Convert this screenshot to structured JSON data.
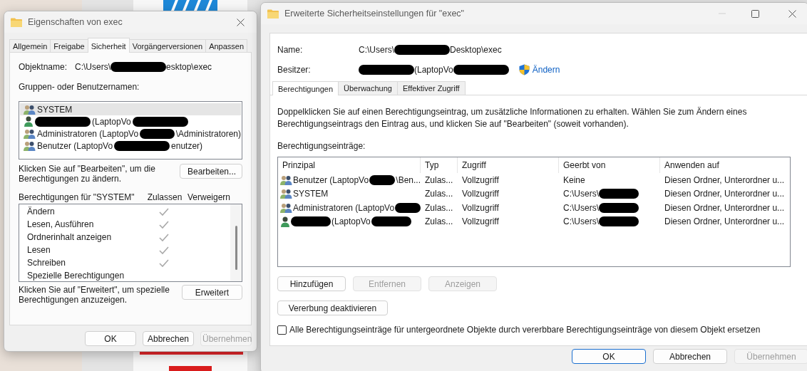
{
  "left_window": {
    "title": "Eigenschaften von exec",
    "tabs": [
      {
        "label": "Allgemein",
        "selected": false
      },
      {
        "label": "Freigabe",
        "selected": false
      },
      {
        "label": "Sicherheit",
        "selected": true
      },
      {
        "label": "Vorgängerversionen",
        "selected": false
      },
      {
        "label": "Anpassen",
        "selected": false
      }
    ],
    "object_name": {
      "label": "Objektname:",
      "value": [
        {
          "kind": "text",
          "text": "C:\\Users\\"
        },
        {
          "kind": "redacted"
        },
        {
          "kind": "text",
          "text": "esktop\\exec"
        }
      ]
    },
    "groups_label": "Gruppen- oder Benutzernamen:",
    "principals": [
      {
        "kind": "group",
        "selected": true,
        "name": [
          {
            "kind": "text",
            "text": "SYSTEM"
          }
        ]
      },
      {
        "kind": "user",
        "selected": false,
        "name": [
          {
            "kind": "redacted"
          },
          {
            "kind": "text",
            "text": "(LaptopVo"
          },
          {
            "kind": "redacted"
          }
        ]
      },
      {
        "kind": "group",
        "selected": false,
        "name": [
          {
            "kind": "text",
            "text": "Administratoren (LaptopVo"
          },
          {
            "kind": "redacted"
          },
          {
            "kind": "text",
            "text": "\\Administratoren)"
          }
        ]
      },
      {
        "kind": "group",
        "selected": false,
        "name": [
          {
            "kind": "text",
            "text": "Benutzer (LaptopVo"
          },
          {
            "kind": "redacted"
          },
          {
            "kind": "text",
            "text": "enutzer)"
          }
        ]
      }
    ],
    "edit_hint": "Klicken Sie auf \"Bearbeiten\", um die Berechtigungen zu ändern.",
    "edit_button": "Bearbeiten...",
    "permissions_label": "Berechtigungen für \"SYSTEM\"",
    "allow_header": "Zulassen",
    "deny_header": "Verweigern",
    "permissions": [
      {
        "name": "Ändern",
        "allow": true,
        "deny": false
      },
      {
        "name": "Lesen, Ausführen",
        "allow": true,
        "deny": false
      },
      {
        "name": "Ordnerinhalt anzeigen",
        "allow": true,
        "deny": false
      },
      {
        "name": "Lesen",
        "allow": true,
        "deny": false
      },
      {
        "name": "Schreiben",
        "allow": true,
        "deny": false
      },
      {
        "name": "Spezielle Berechtigungen",
        "allow": false,
        "deny": false
      }
    ],
    "advanced_hint": "Klicken Sie auf \"Erweitert\", um spezielle Berechtigungen anzuzeigen.",
    "advanced_button": "Erweitert",
    "buttons": [
      {
        "label": "OK",
        "disabled": false,
        "default": false
      },
      {
        "label": "Abbrechen",
        "disabled": false,
        "default": false
      },
      {
        "label": "Übernehmen",
        "disabled": true,
        "default": false
      }
    ]
  },
  "right_window": {
    "title": "Erweiterte Sicherheitseinstellungen für \"exec\"",
    "name": {
      "label": "Name:",
      "value": [
        {
          "kind": "text",
          "text": "C:\\Users\\"
        },
        {
          "kind": "redacted"
        },
        {
          "kind": "text",
          "text": "Desktop\\exec"
        }
      ]
    },
    "owner": {
      "label": "Besitzer:",
      "value": [
        {
          "kind": "redacted"
        },
        {
          "kind": "text",
          "text": "(LaptopVo"
        },
        {
          "kind": "redacted"
        }
      ],
      "change_link": "Ändern"
    },
    "tabs": [
      {
        "label": "Berechtigungen",
        "selected": true
      },
      {
        "label": "Überwachung",
        "selected": false
      },
      {
        "label": "Effektiver Zugriff",
        "selected": false
      }
    ],
    "description": "Doppelklicken Sie auf einen Berechtigungseintrag, um zusätzliche Informationen zu erhalten. Wählen Sie zum Ändern eines Berechtigungseintrags den Eintrag aus, und klicken Sie auf \"Bearbeiten\" (soweit vorhanden).",
    "entries_label": "Berechtigungseinträge:",
    "table": {
      "columns": [
        "Prinzipal",
        "Typ",
        "Zugriff",
        "Geerbt von",
        "Anwenden auf"
      ],
      "rows": [
        {
          "kind": "group",
          "principal": [
            {
              "kind": "text",
              "text": "Benutzer (LaptopVo"
            },
            {
              "kind": "redacted"
            },
            {
              "kind": "text",
              "text": "\\Ben..."
            }
          ],
          "type": "Zulas...",
          "access": "Vollzugriff",
          "inherited_from": [
            {
              "kind": "text",
              "text": "Keine"
            }
          ],
          "applies_to": "Diesen Ordner, Unterordner u..."
        },
        {
          "kind": "group",
          "principal": [
            {
              "kind": "text",
              "text": "SYSTEM"
            }
          ],
          "type": "Zulas...",
          "access": "Vollzugriff",
          "inherited_from": [
            {
              "kind": "text",
              "text": "C:\\Users\\"
            },
            {
              "kind": "redacted"
            }
          ],
          "applies_to": "Diesen Ordner, Unterordner u..."
        },
        {
          "kind": "group",
          "principal": [
            {
              "kind": "text",
              "text": "Administratoren (LaptopVo"
            },
            {
              "kind": "redacted"
            }
          ],
          "type": "Zulas...",
          "access": "Vollzugriff",
          "inherited_from": [
            {
              "kind": "text",
              "text": "C:\\Users\\"
            },
            {
              "kind": "redacted"
            }
          ],
          "applies_to": "Diesen Ordner, Unterordner u..."
        },
        {
          "kind": "user",
          "principal": [
            {
              "kind": "redacted"
            },
            {
              "kind": "text",
              "text": "(LaptopVo"
            },
            {
              "kind": "redacted"
            }
          ],
          "type": "Zulas...",
          "access": "Vollzugriff",
          "inherited_from": [
            {
              "kind": "text",
              "text": "C:\\Users\\"
            },
            {
              "kind": "redacted"
            }
          ],
          "applies_to": "Diesen Ordner, Unterordner u..."
        }
      ]
    },
    "entry_buttons": [
      {
        "label": "Hinzufügen",
        "disabled": false
      },
      {
        "label": "Entfernen",
        "disabled": true
      },
      {
        "label": "Anzeigen",
        "disabled": true
      }
    ],
    "inheritance_button": "Vererbung deaktivieren",
    "replace_checkbox": {
      "label": "Alle Berechtigungseinträge für untergeordnete Objekte durch vererbbare Berechtigungseinträge von diesem Objekt ersetzen",
      "checked": false
    },
    "buttons": [
      {
        "label": "OK",
        "disabled": false,
        "default": true
      },
      {
        "label": "Abbrechen",
        "disabled": false,
        "default": false
      },
      {
        "label": "Übernehmen",
        "disabled": true,
        "default": false
      }
    ]
  }
}
